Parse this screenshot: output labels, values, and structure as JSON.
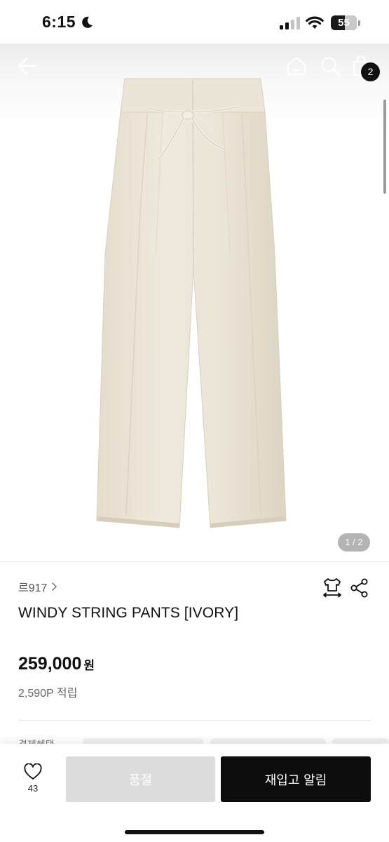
{
  "status_bar": {
    "time": "6:15",
    "battery_percent": "55",
    "battery_level": 0.55
  },
  "header": {
    "cart_count": "2"
  },
  "gallery": {
    "pager": "1 / 2"
  },
  "product": {
    "brand": "르917",
    "title": "WINDY STRING PANTS [IVORY]",
    "price": "259,000",
    "currency": "원",
    "points": "2,590P 적립",
    "image_color": "#ede8dc"
  },
  "peek": {
    "label": "결제혜택"
  },
  "bottom_bar": {
    "like_count": "43",
    "soldout_label": "품절",
    "restock_label": "재입고 알림"
  }
}
